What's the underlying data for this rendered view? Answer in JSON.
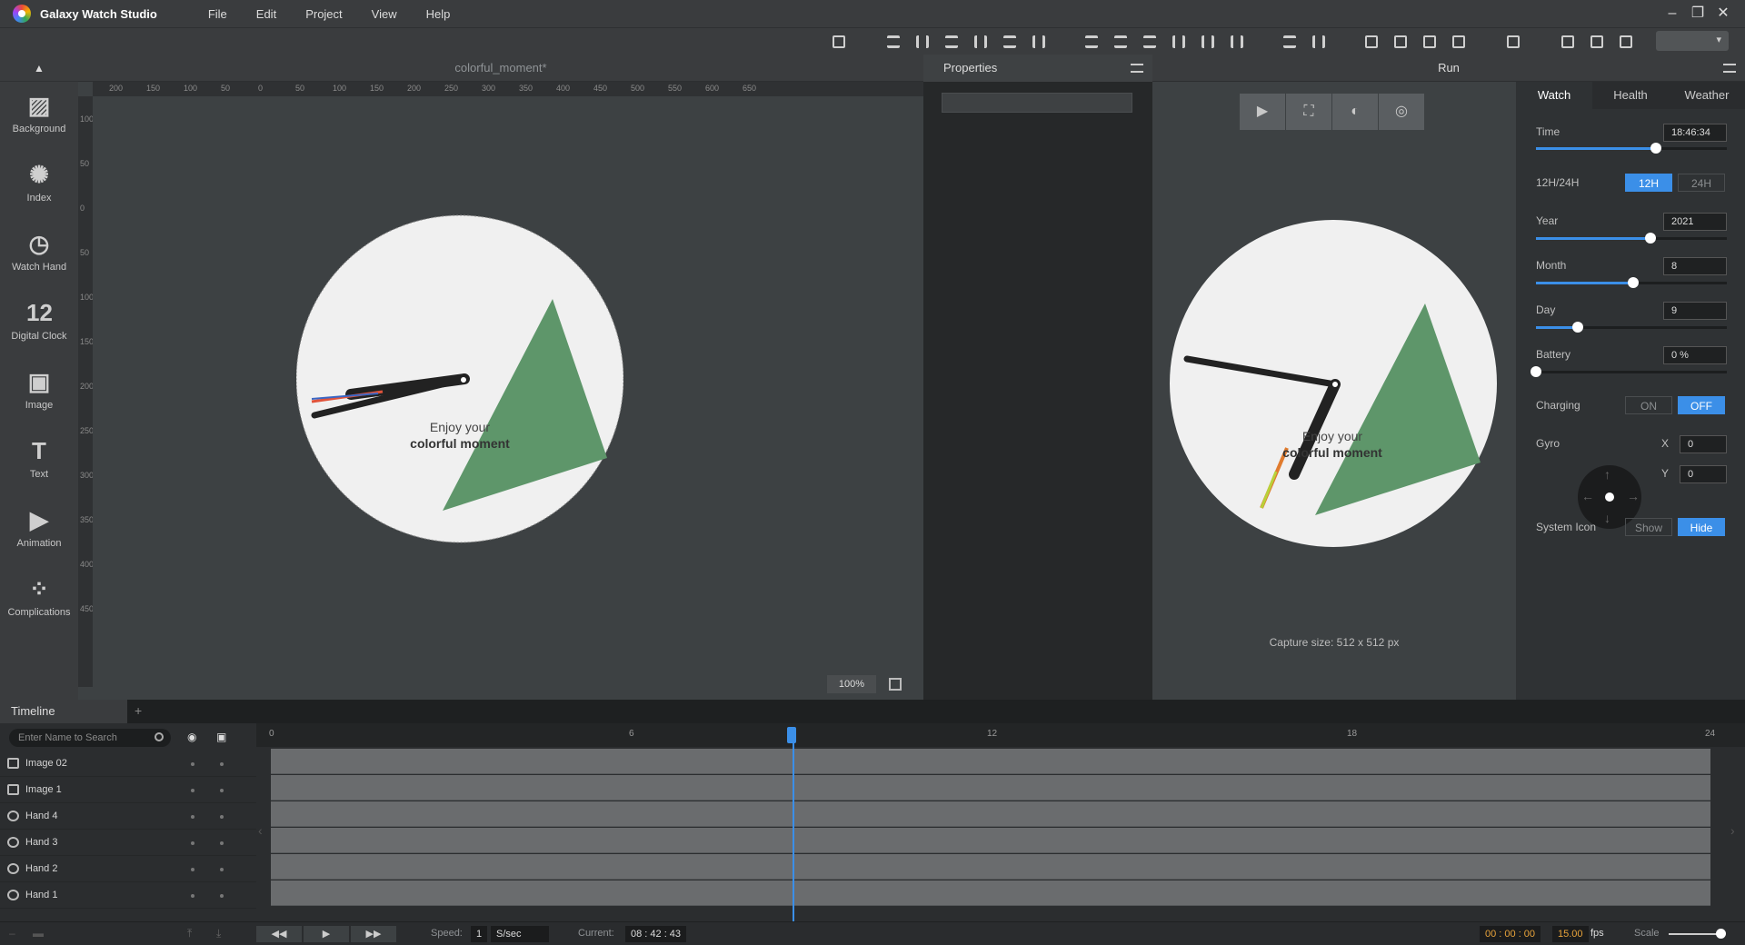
{
  "app": {
    "title": "Galaxy Watch Studio"
  },
  "menu": [
    "File",
    "Edit",
    "Project",
    "View",
    "Help"
  ],
  "window_controls": [
    "–",
    "❐",
    "✕"
  ],
  "tools": [
    {
      "label": "Background",
      "icon": "background-icon",
      "glyph": "▨"
    },
    {
      "label": "Index",
      "icon": "index-icon",
      "glyph": "✺"
    },
    {
      "label": "Watch Hand",
      "icon": "watch-hand-icon",
      "glyph": "◷"
    },
    {
      "label": "Digital Clock",
      "icon": "digital-clock-icon",
      "glyph": "12"
    },
    {
      "label": "Image",
      "icon": "image-icon",
      "glyph": "▣"
    },
    {
      "label": "Text",
      "icon": "text-icon",
      "glyph": "T"
    },
    {
      "label": "Animation",
      "icon": "animation-icon",
      "glyph": "▶"
    },
    {
      "label": "Complications",
      "icon": "complications-icon",
      "glyph": "⁘"
    }
  ],
  "canvas": {
    "tab_title": "colorful_moment*",
    "zoom": "100%",
    "ruler_h": [
      "200",
      "150",
      "100",
      "50",
      "0",
      "50",
      "100",
      "150",
      "200",
      "250",
      "300",
      "350",
      "400",
      "450",
      "500",
      "550",
      "600",
      "650"
    ],
    "ruler_v": [
      "100",
      "50",
      "0",
      "50",
      "100",
      "150",
      "200",
      "250",
      "300",
      "350",
      "400",
      "450"
    ],
    "watch_text_line1": "Enjoy your",
    "watch_text_line2": "colorful moment"
  },
  "properties": {
    "title": "Properties"
  },
  "run": {
    "title": "Run",
    "capture_size": "Capture size: 512 x 512 px",
    "watch_text_line1": "Enjoy your",
    "watch_text_line2": "colorful moment"
  },
  "settings": {
    "tabs": [
      "Watch",
      "Health",
      "Weather"
    ],
    "time_label": "Time",
    "time_value": "18:46:34",
    "time_pct": 0.63,
    "hour_format_label": "12H/24H",
    "hour_12": "12H",
    "hour_24": "24H",
    "year_label": "Year",
    "year_value": "2021",
    "year_pct": 0.6,
    "month_label": "Month",
    "month_value": "8",
    "month_pct": 0.51,
    "day_label": "Day",
    "day_value": "9",
    "day_pct": 0.22,
    "battery_label": "Battery",
    "battery_value": "0 %",
    "battery_pct": 0.0,
    "charging_label": "Charging",
    "charging_on": "ON",
    "charging_off": "OFF",
    "gyro_label": "Gyro",
    "gyro_x_label": "X",
    "gyro_x": "0",
    "gyro_y_label": "Y",
    "gyro_y": "0",
    "system_icon_label": "System Icon",
    "system_show": "Show",
    "system_hide": "Hide"
  },
  "timeline": {
    "tab": "Timeline",
    "search_placeholder": "Enter Name to Search",
    "layers": [
      "Image 02",
      "Image 1",
      "Hand 4",
      "Hand 3",
      "Hand 2",
      "Hand 1"
    ],
    "hours": [
      "0",
      "6",
      "12",
      "18",
      "24"
    ]
  },
  "bottom": {
    "speed_label": "Speed:",
    "speed_value": "1",
    "speed_unit": "S/sec",
    "current_label": "Current:",
    "current_value": "08 : 42 : 43",
    "time_value": "00 : 00 : 00",
    "fps_value": "15.00",
    "fps_label": "fps",
    "scale_label": "Scale"
  },
  "colors": {
    "accent": "#3b8fe8",
    "triangle": "#5e966a",
    "watch_face": "#f0f0f0",
    "hand": "#222222"
  }
}
